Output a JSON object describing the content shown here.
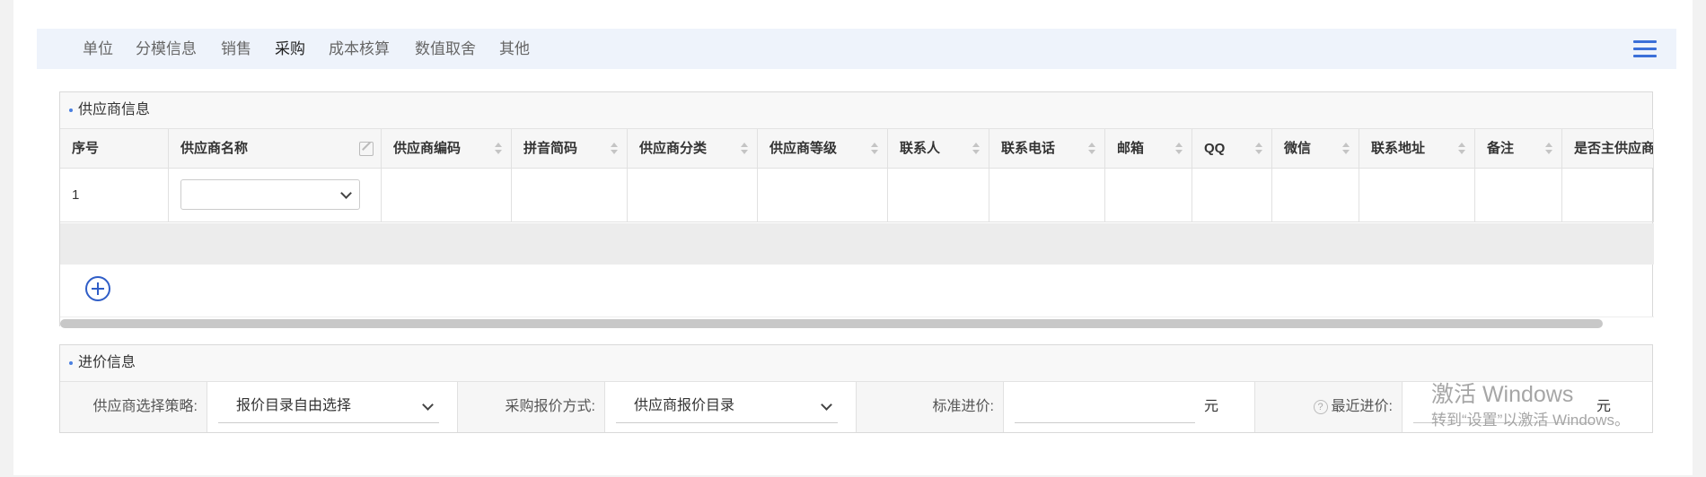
{
  "tabs": [
    {
      "label": "单位"
    },
    {
      "label": "分模信息"
    },
    {
      "label": "销售"
    },
    {
      "label": "采购",
      "active": true
    },
    {
      "label": "成本核算"
    },
    {
      "label": "数值取舍"
    },
    {
      "label": "其他"
    }
  ],
  "supplier_section": {
    "title": "供应商信息",
    "columns": [
      "序号",
      "供应商名称",
      "供应商编码",
      "拼音简码",
      "供应商分类",
      "供应商等级",
      "联系人",
      "联系电话",
      "邮箱",
      "QQ",
      "微信",
      "联系地址",
      "备注",
      "是否主供应商"
    ],
    "rows": [
      {
        "index": "1",
        "supplier_name": ""
      }
    ]
  },
  "price_section": {
    "title": "进价信息",
    "strategy_label": "供应商选择策略:",
    "strategy_value": "报价目录自由选择",
    "quote_label": "采购报价方式:",
    "quote_value": "供应商报价目录",
    "std_price_label": "标准进价:",
    "std_price_value": "",
    "unit": "元",
    "recent_price_label": "最近进价:",
    "recent_unit": "元"
  },
  "watermark": {
    "line1": "激活 Windows",
    "line2": "转到“设置”以激活 Windows。"
  },
  "colors": {
    "accent": "#2f5dc7",
    "tab_bar": "#eef3fb"
  }
}
